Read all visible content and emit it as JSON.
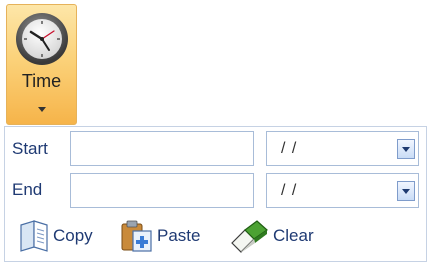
{
  "ribbon": {
    "time_label": "Time",
    "clock_icon": "clock-icon",
    "dropdown_icon": "chevron-down-icon",
    "bg_color": "#fbd27a"
  },
  "form": {
    "start": {
      "label": "Start",
      "text_value": "",
      "date_value": "/ /"
    },
    "end": {
      "label": "End",
      "text_value": "",
      "date_value": "/ /"
    }
  },
  "actions": {
    "copy": {
      "label": "Copy",
      "icon": "copy-icon"
    },
    "paste": {
      "label": "Paste",
      "icon": "paste-icon"
    },
    "clear": {
      "label": "Clear",
      "icon": "eraser-icon"
    }
  },
  "colors": {
    "label_text": "#1f3a73",
    "field_border": "#a8bcd8",
    "panel_border": "#c6d2e4"
  }
}
